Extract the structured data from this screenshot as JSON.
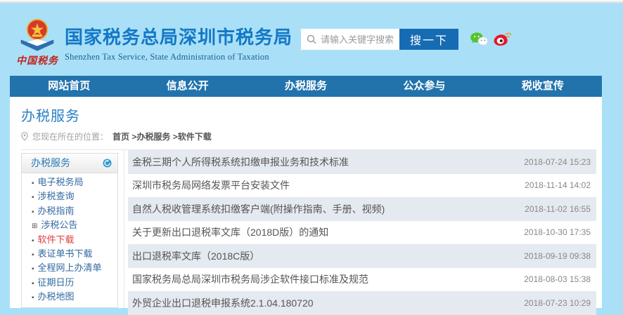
{
  "header": {
    "logo_caption": "中国税务",
    "title": "国家税务总局深圳市税务局",
    "subtitle": "Shenzhen Tax Service, State Administration of Taxation",
    "search": {
      "placeholder": "请输入关键字搜索",
      "button_label": "搜一下"
    }
  },
  "nav": {
    "items": [
      {
        "label": "网站首页"
      },
      {
        "label": "信息公开"
      },
      {
        "label": "办税服务"
      },
      {
        "label": "公众参与"
      },
      {
        "label": "税收宣传"
      }
    ]
  },
  "page": {
    "title": "办税服务",
    "breadcrumb_prefix": "您现在所在的位置：",
    "breadcrumb_path": "首页 >办税服务 >软件下载"
  },
  "sidebar": {
    "header": "办税服务",
    "items": [
      {
        "label": "电子税务局",
        "glyph": "▪",
        "active": false
      },
      {
        "label": "涉税查询",
        "glyph": "▪",
        "active": false
      },
      {
        "label": "办税指南",
        "glyph": "▪",
        "active": false
      },
      {
        "label": "涉税公告",
        "glyph": "⊞",
        "active": false
      },
      {
        "label": "软件下载",
        "glyph": "▪",
        "active": true
      },
      {
        "label": "表证单书下载",
        "glyph": "▪",
        "active": false
      },
      {
        "label": "全程网上办清单",
        "glyph": "▪",
        "active": false
      },
      {
        "label": "征期日历",
        "glyph": "▪",
        "active": false
      },
      {
        "label": "办税地图",
        "glyph": "▪",
        "active": false
      }
    ]
  },
  "list": {
    "items": [
      {
        "title": "金税三期个人所得税系统扣缴申报业务和技术标准",
        "date": "2018-07-24 15:23"
      },
      {
        "title": "深圳市税务局网络发票平台安装文件",
        "date": "2018-11-14 14:02"
      },
      {
        "title": "自然人税收管理系统扣缴客户端(附操作指南、手册、视频)",
        "date": "2018-11-02 16:55"
      },
      {
        "title": "关于更新出口退税率文库（2018D版）的通知",
        "date": "2018-10-30 17:35"
      },
      {
        "title": "出口退税率文库（2018C版）",
        "date": "2018-09-19 09:38"
      },
      {
        "title": "国家税务局总局深圳市税务局涉企软件接口标准及规范",
        "date": "2018-08-03 15:38"
      },
      {
        "title": "外贸企业出口退税申报系统2.1.04.180720",
        "date": "2018-07-23 10:29"
      }
    ]
  },
  "colors": {
    "page_bg": "#a9e0f8",
    "nav_bg": "#2273ac",
    "brand_blue": "#1478c5",
    "search_button_bg": "#176bb3",
    "active_item_red": "#e03c3c",
    "row_alt_bg": "#e5e9f0"
  }
}
